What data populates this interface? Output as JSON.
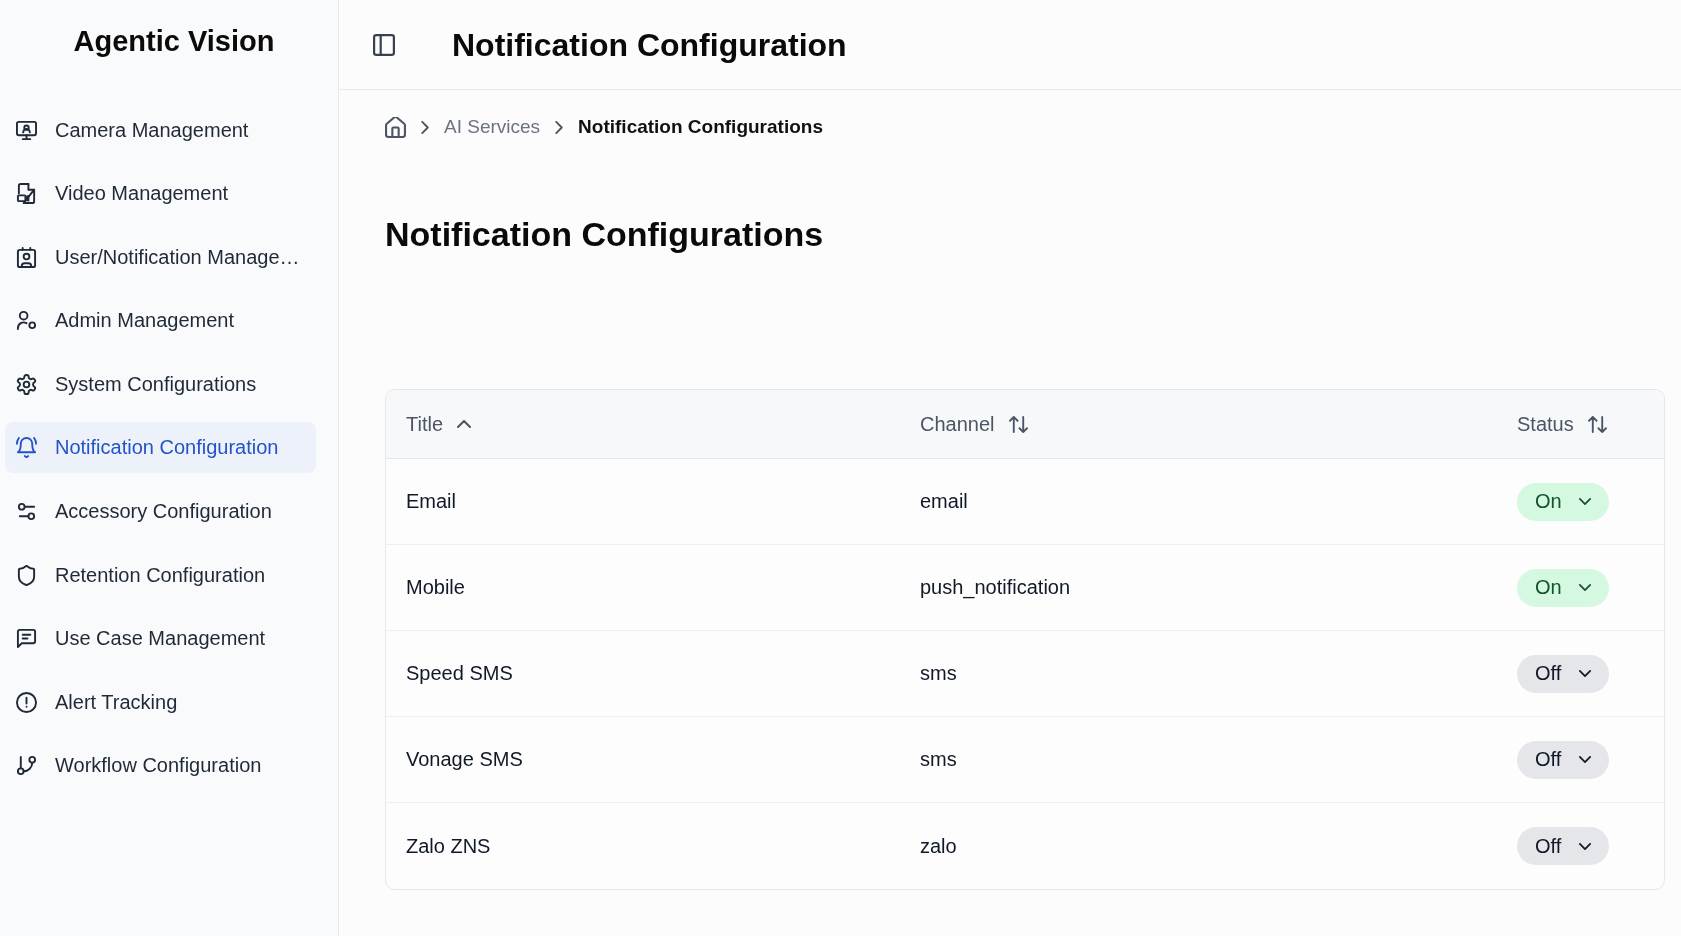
{
  "sidebar": {
    "logo": "Agentic Vision",
    "items": [
      {
        "label": "Camera Management",
        "selected": false
      },
      {
        "label": "Video Management",
        "selected": false
      },
      {
        "label": "User/Notification Manage…",
        "selected": false
      },
      {
        "label": "Admin Management",
        "selected": false
      },
      {
        "label": "System Configurations",
        "selected": false
      },
      {
        "label": "Notification Configuration",
        "selected": true
      },
      {
        "label": "Accessory Configuration",
        "selected": false
      },
      {
        "label": "Retention Configuration",
        "selected": false
      },
      {
        "label": "Use Case Management",
        "selected": false
      },
      {
        "label": "Alert Tracking",
        "selected": false
      },
      {
        "label": "Workflow Configuration",
        "selected": false
      }
    ]
  },
  "header": {
    "title": "Notification Configuration"
  },
  "breadcrumb": [
    {
      "label": "AI Services",
      "current": false
    },
    {
      "label": "Notification Configurations",
      "current": true
    }
  ],
  "page": {
    "heading": "Notification Configurations"
  },
  "table": {
    "columns": [
      {
        "label": "Title",
        "sorted": true
      },
      {
        "label": "Channel",
        "sorted": false
      },
      {
        "label": "Status",
        "sorted": false
      }
    ],
    "rows": [
      {
        "title": "Email",
        "channel": "email",
        "status": "On",
        "on": true
      },
      {
        "title": "Mobile",
        "channel": "push_notification",
        "status": "On",
        "on": true
      },
      {
        "title": "Speed SMS",
        "channel": "sms",
        "status": "Off",
        "on": false
      },
      {
        "title": "Vonage SMS",
        "channel": "sms",
        "status": "Off",
        "on": false
      },
      {
        "title": "Zalo ZNS",
        "channel": "zalo",
        "status": "Off",
        "on": false
      }
    ]
  }
}
